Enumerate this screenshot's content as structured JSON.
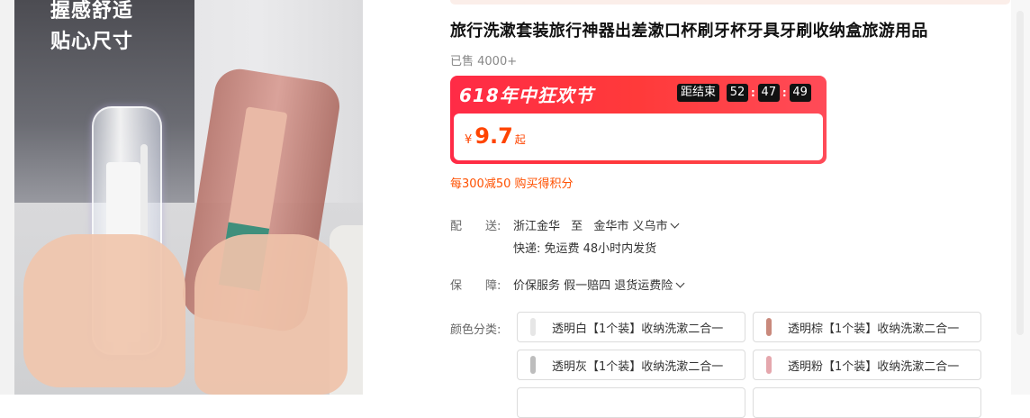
{
  "gallery": {
    "slogan_line1": "握感舒适",
    "slogan_line2": "贴心尺寸"
  },
  "product": {
    "title": "旅行洗漱套装旅行神器出差漱口杯刷牙杯牙具牙刷收纳盒旅游用品",
    "sold": "已售 4000+"
  },
  "promo": {
    "name": "618年中狂欢节",
    "countdown_label": "距结束",
    "hours": "52",
    "minutes": "47",
    "seconds": "49",
    "currency": "¥",
    "price": "9.7",
    "price_suffix": "起",
    "accent": "#ff2b46"
  },
  "coupon": "每300减50 购买得积分",
  "delivery": {
    "label": "配　　送:",
    "from": "浙江金华",
    "to_word": "至",
    "destination": "金华市 义乌市",
    "shipping": "快递: 免运费  48小时内发货"
  },
  "guarantee": {
    "label": "保　　障:",
    "value": "价保服务 假一赔四 退货运费险"
  },
  "color": {
    "label": "颜色分类:",
    "options": [
      {
        "label": "透明白【1个装】收纳洗漱二合一",
        "swatch": "#e6e6e6"
      },
      {
        "label": "透明棕【1个装】收纳洗漱二合一",
        "swatch": "#c9897c"
      },
      {
        "label": "透明灰【1个装】收纳洗漱二合一",
        "swatch": "#bdbdbd"
      },
      {
        "label": "透明粉【1个装】收纳洗漱二合一",
        "swatch": "#e5a7ad"
      }
    ]
  }
}
